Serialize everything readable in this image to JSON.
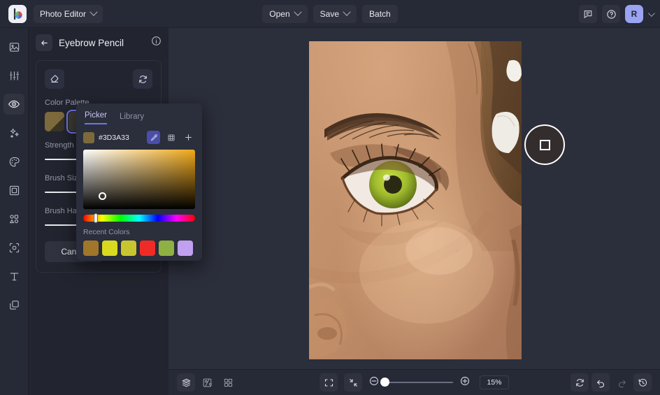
{
  "topbar": {
    "logo_name": "brand-logo",
    "app_menu_label": "Photo Editor",
    "open_label": "Open",
    "save_label": "Save",
    "batch_label": "Batch",
    "feedback_icon": "comment-icon",
    "help_icon": "help-circle-icon",
    "avatar_initial": "R"
  },
  "rail": {
    "items": [
      {
        "name": "sidebar-item-image",
        "icon": "image-icon",
        "active": false
      },
      {
        "name": "sidebar-item-adjust",
        "icon": "sliders-icon",
        "active": false
      },
      {
        "name": "sidebar-item-retouch",
        "icon": "eye-icon",
        "active": true
      },
      {
        "name": "sidebar-item-effects",
        "icon": "sparkles-icon",
        "active": false
      },
      {
        "name": "sidebar-item-color",
        "icon": "palette-icon",
        "active": false
      },
      {
        "name": "sidebar-item-frame",
        "icon": "frame-icon",
        "active": false
      },
      {
        "name": "sidebar-item-elements",
        "icon": "shapes-icon",
        "active": false
      },
      {
        "name": "sidebar-item-crop",
        "icon": "crop-focus-icon",
        "active": false
      },
      {
        "name": "sidebar-item-text",
        "icon": "text-icon",
        "active": false
      },
      {
        "name": "sidebar-item-layers",
        "icon": "layers-copy-icon",
        "active": false
      }
    ]
  },
  "panel": {
    "back_icon": "arrow-left-icon",
    "title": "Eyebrow Pencil",
    "info_icon": "info-circle-icon",
    "erase_icon": "eraser-icon",
    "reset_icon": "refresh-icon",
    "color_palette_label": "Color Palette",
    "palette_swatches": [
      {
        "color": "#7c6a3c",
        "selected": false
      },
      {
        "color": "#3d3a33",
        "selected": true
      }
    ],
    "sliders": [
      {
        "label": "Strength",
        "knob_pct": 100
      },
      {
        "label": "Brush Size",
        "knob_pct": 52
      },
      {
        "label": "Brush Hardness",
        "knob_pct": 100
      }
    ],
    "cancel_label": "Cancel"
  },
  "picker": {
    "tabs": [
      {
        "label": "Picker",
        "active": true
      },
      {
        "label": "Library",
        "active": false
      }
    ],
    "hex_value": "#3D3A33",
    "current_color": "#7c6a3c",
    "eyedropper_icon": "eyedropper-icon",
    "eyedropper_active": true,
    "grid_icon": "grid-icon",
    "add_icon": "plus-icon",
    "saturation_accent": "#f0a818",
    "recent_label": "Recent Colors",
    "recent_colors": [
      "#a0762a",
      "#d9d91f",
      "#c8c630",
      "#ef2b27",
      "#8fb043",
      "#c2a0f0"
    ]
  },
  "canvas": {
    "brush_cursor_name": "brush-cursor",
    "photo_alt": "close-up portrait of woman's eye and cheek"
  },
  "bottombar": {
    "left_tools": [
      {
        "name": "layers-button",
        "icon": "layers-icon",
        "filled": true
      },
      {
        "name": "compare-button",
        "icon": "compare-icon",
        "filled": false
      },
      {
        "name": "grid-view-button",
        "icon": "grid-view-icon",
        "filled": false
      }
    ],
    "fit_icon": "fit-screen-icon",
    "actual-size_icon": "collapse-icon",
    "zoom_out_icon": "minus-circle-icon",
    "zoom_in_icon": "plus-circle-icon",
    "zoom_value": "15%",
    "zoom_knob_pct": 4,
    "right_tools": [
      {
        "name": "reset-view-button",
        "icon": "refresh-icon",
        "dim": false
      },
      {
        "name": "undo-button",
        "icon": "undo-icon",
        "dim": false
      },
      {
        "name": "redo-button",
        "icon": "redo-icon",
        "dim": true
      },
      {
        "name": "history-button",
        "icon": "history-icon",
        "dim": false
      }
    ]
  }
}
